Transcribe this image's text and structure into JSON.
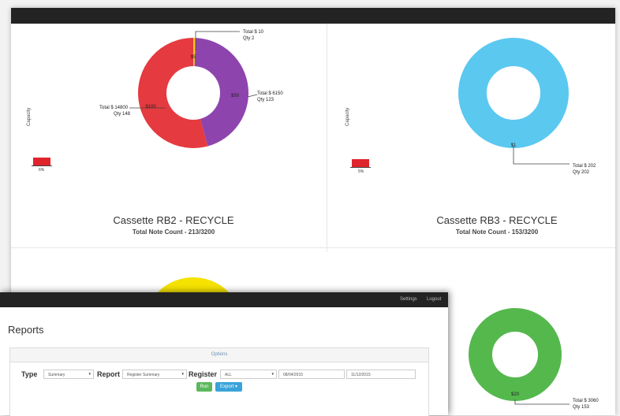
{
  "cassettes": [
    {
      "title": "Cassette RB2 - RECYCLE",
      "subtitle": "Total Note Count - 213/3200",
      "capacity_label": "Capacity",
      "capacity_percent": "6%",
      "segments": [
        {
          "label": "$5",
          "total": "Total $ 10",
          "qty": "Qty 2",
          "count": 2,
          "color": "#f5c518"
        },
        {
          "label": "$50",
          "total": "Total $ 6150",
          "qty": "Qty 123",
          "count": 123,
          "color": "#8e44ad"
        },
        {
          "label": "$100",
          "total": "Total $ 14800",
          "qty": "Qty 148",
          "count": 148,
          "color": "#e53a3f"
        }
      ]
    },
    {
      "title": "Cassette RB3 - RECYCLE",
      "subtitle": "Total Note Count - 153/3200",
      "capacity_label": "Capacity",
      "capacity_percent": "5%",
      "segments": [
        {
          "label": "$1",
          "total": "Total $ 202",
          "qty": "Qty 202",
          "count": 202,
          "color": "#5bc8f0"
        }
      ]
    },
    {
      "segments": [
        {
          "label": "$20",
          "total": "Total $ 3060",
          "qty": "Qty 153",
          "count": 153,
          "color": "#55b84d"
        }
      ]
    },
    {
      "segments": [
        {
          "color": "#f5e200"
        }
      ]
    }
  ],
  "front_window": {
    "nav": {
      "settings": "Settings",
      "logout": "Logout"
    },
    "page_title": "Reports",
    "panel_heading": "Options",
    "filters": {
      "type_label": "Type",
      "type_value": "Summary",
      "report_label": "Report",
      "report_value": "Register Summary",
      "register_label": "Register",
      "register_value": "ALL",
      "start_date": "08/04/2015",
      "end_date": "11/12/2015"
    },
    "buttons": {
      "run": "Run",
      "export": "Export"
    },
    "colors": {
      "run": "#5cb85c",
      "export": "#3aa3d9"
    }
  }
}
